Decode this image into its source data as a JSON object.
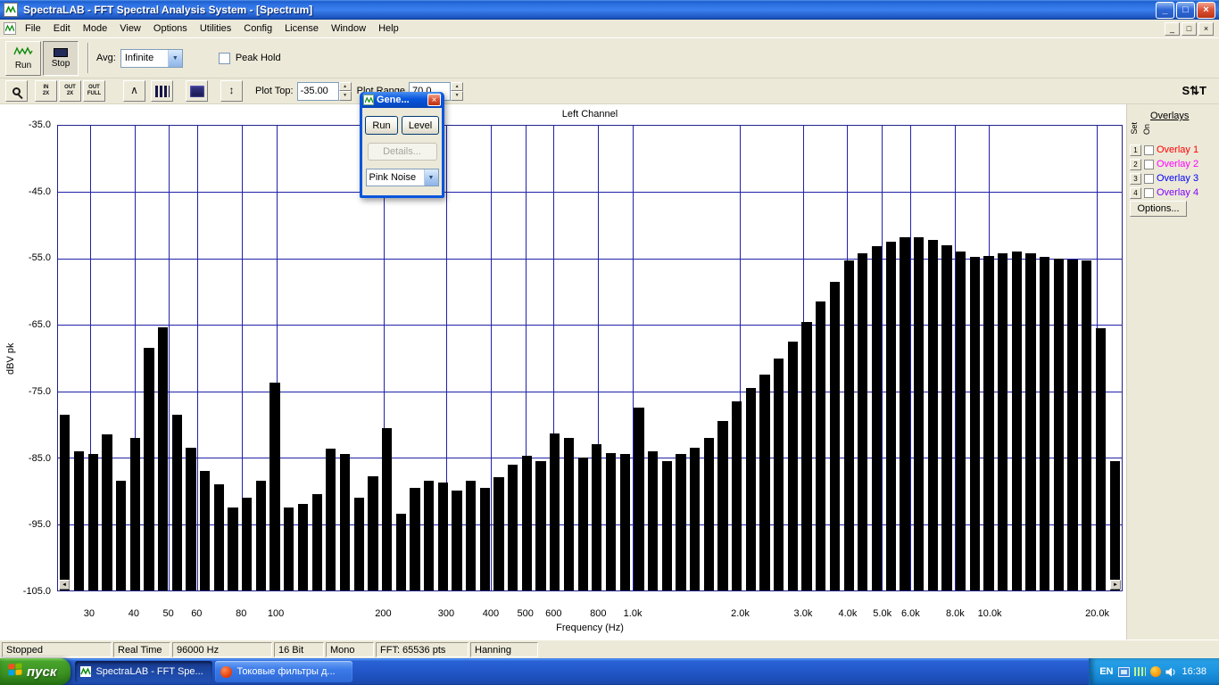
{
  "window": {
    "title": "SpectraLAB - FFT Spectral Analysis System - [Spectrum]",
    "minimize_glyph": "_",
    "restore_glyph": "□",
    "close_glyph": "×"
  },
  "menubar": {
    "items": [
      "File",
      "Edit",
      "Mode",
      "View",
      "Options",
      "Utilities",
      "Config",
      "License",
      "Window",
      "Help"
    ]
  },
  "toolbar": {
    "run_label": "Run",
    "stop_label": "Stop",
    "avg_label": "Avg:",
    "avg_value": "Infinite",
    "peak_hold_label": "Peak Hold",
    "plot_top_label": "Plot Top:",
    "plot_top_value": "-35.00",
    "plot_range_label": "Plot Range",
    "plot_range_value": "70.0",
    "spinner_up": "▲",
    "spinner_down": "▼",
    "combo_arrow": "▼",
    "st_label": "S⇅T",
    "tools": [
      {
        "name": "zoom-icon",
        "label": ""
      },
      {
        "name": "zoom-in-2x-icon",
        "label": "IN\n2X"
      },
      {
        "name": "zoom-out-2x-icon",
        "label": "OUT\n2X"
      },
      {
        "name": "zoom-out-full-icon",
        "label": "OUT\nFULL"
      },
      {
        "name": "peak-cursor-icon",
        "label": "∧"
      },
      {
        "name": "spectrum-display-icon",
        "label": ""
      },
      {
        "name": "spectrogram-display-icon",
        "label": ""
      },
      {
        "name": "amplitude-range-icon",
        "label": "↕"
      }
    ]
  },
  "generator_dialog": {
    "title": "Gene...",
    "close_glyph": "×",
    "run_label": "Run",
    "level_label": "Level",
    "details_label": "Details...",
    "signal_value": "Pink Noise",
    "combo_arrow": "▼"
  },
  "chart_ui": {
    "scroll_left": "◄",
    "scroll_right": "►"
  },
  "chart_data": {
    "type": "bar",
    "title": "Left Channel",
    "ylabel": "dBV pk",
    "xlabel": "Frequency (Hz)",
    "ylim": [
      -105,
      -35
    ],
    "y_ticks": [
      "-35.0",
      "-45.0",
      "-55.0",
      "-65.0",
      "-75.0",
      "-85.0",
      "-95.0",
      "-105.0"
    ],
    "xlim_hz": [
      24.4,
      23560
    ],
    "x_ticks": [
      {
        "f": 30,
        "label": "30"
      },
      {
        "f": 40,
        "label": "40"
      },
      {
        "f": 50,
        "label": "50"
      },
      {
        "f": 60,
        "label": "60"
      },
      {
        "f": 80,
        "label": "80"
      },
      {
        "f": 100,
        "label": "100"
      },
      {
        "f": 200,
        "label": "200"
      },
      {
        "f": 300,
        "label": "300"
      },
      {
        "f": 400,
        "label": "400"
      },
      {
        "f": 500,
        "label": "500"
      },
      {
        "f": 600,
        "label": "600"
      },
      {
        "f": 800,
        "label": "800"
      },
      {
        "f": 1000,
        "label": "1.0k"
      },
      {
        "f": 2000,
        "label": "2.0k"
      },
      {
        "f": 3000,
        "label": "3.0k"
      },
      {
        "f": 4000,
        "label": "4.0k"
      },
      {
        "f": 5000,
        "label": "5.0k"
      },
      {
        "f": 6000,
        "label": "6.0k"
      },
      {
        "f": 8000,
        "label": "8.0k"
      },
      {
        "f": 10000,
        "label": "10.0k"
      },
      {
        "f": 20000,
        "label": "20.0k"
      }
    ],
    "grid": true,
    "bar_color": "#000000",
    "grid_color": "#2121aa",
    "values_dbv": [
      -78.5,
      -84.0,
      -84.5,
      -81.5,
      -88.5,
      -82.0,
      -68.5,
      -65.3,
      -78.5,
      -83.5,
      -87.0,
      -89.0,
      -92.5,
      -91.0,
      -88.5,
      -73.7,
      -92.5,
      -92.0,
      -90.5,
      -83.7,
      -84.5,
      -91.0,
      -87.8,
      -80.5,
      -93.5,
      -89.5,
      -88.5,
      -88.7,
      -90.0,
      -88.5,
      -89.5,
      -88.0,
      -86.0,
      -84.7,
      -85.5,
      -81.3,
      -82.0,
      -85.0,
      -83.0,
      -84.3,
      -84.5,
      -77.5,
      -84.0,
      -85.5,
      -84.5,
      -83.5,
      -82.0,
      -79.5,
      -76.5,
      -74.5,
      -72.5,
      -70.0,
      -67.5,
      -64.5,
      -61.5,
      -58.5,
      -55.3,
      -54.2,
      -53.2,
      -52.4,
      -51.8,
      -51.8,
      -52.2,
      -53.0,
      -54.0,
      -54.8,
      -54.6,
      -54.2,
      -53.9,
      -54.2,
      -54.7,
      -55.0,
      -55.2,
      -55.3,
      -65.5,
      -85.5
    ]
  },
  "overlays": {
    "title": "Overlays",
    "set_header": "Set",
    "on_header": "On",
    "options_label": "Options...",
    "items": [
      {
        "num": "1",
        "label": "Overlay 1",
        "color": "#ff0000",
        "checked": false
      },
      {
        "num": "2",
        "label": "Overlay 2",
        "color": "#ff00ff",
        "checked": false
      },
      {
        "num": "3",
        "label": "Overlay 3",
        "color": "#0000ff",
        "checked": false
      },
      {
        "num": "4",
        "label": "Overlay 4",
        "color": "#8000ff",
        "checked": false
      }
    ]
  },
  "statusbar": {
    "fields": [
      "Stopped",
      "Real Time",
      "96000 Hz",
      "16 Bit",
      "Mono",
      "FFT: 65536 pts",
      "Hanning"
    ]
  },
  "taskbar": {
    "start_label": "пуск",
    "tasks": [
      {
        "label": "SpectraLAB - FFT Spe...",
        "icon": "spectralab-task-icon",
        "active": true
      },
      {
        "label": "Токовые фильтры д...",
        "icon": "browser-task-icon",
        "active": false
      }
    ],
    "tray": {
      "language": "EN",
      "time": "16:38",
      "icons": [
        "network-status-icon",
        "signal-strength-icon",
        "update-notify-icon",
        "volume-icon"
      ]
    }
  }
}
